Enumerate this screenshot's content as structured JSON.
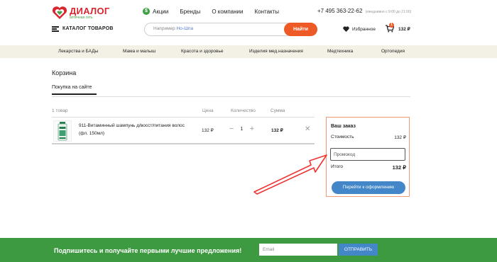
{
  "brand": {
    "name": "ДИАЛОГ",
    "tagline": "аптечная сеть"
  },
  "topnav": {
    "items": [
      {
        "label": "Акции",
        "icon": "dollar-icon"
      },
      {
        "label": "Бренды"
      },
      {
        "label": "О компании"
      },
      {
        "label": "Контакты"
      }
    ]
  },
  "contact": {
    "phone": "+7 495 363-22-62",
    "hours": "(ежедневно с 9:00 до 21:00)"
  },
  "catalog": {
    "label": "КАТАЛОГ ТОВАРОВ"
  },
  "search": {
    "placeholder": "Например",
    "hint": "Но-Шпа",
    "button": "Найти"
  },
  "favorites": {
    "label": "Избранное"
  },
  "cart": {
    "count": "1",
    "total": "132 ₽"
  },
  "categories": [
    "Лекарства и БАДы",
    "Мама и малыш",
    "Красота и здоровье",
    "Изделия мед.назначения",
    "Медтехника",
    "Ортопедия"
  ],
  "page": {
    "title": "Корзина",
    "tab": "Покупка на сайте"
  },
  "table": {
    "count_label": "1 товар",
    "headers": {
      "price": "Цена",
      "quantity": "Количество",
      "sum": "Сумма"
    },
    "rows": [
      {
        "name": "911-Витаминный шампунь д/восст/питания волос (фл. 150мл)",
        "price": "132 ₽",
        "quantity": "1",
        "sum": "132 ₽"
      }
    ]
  },
  "order": {
    "title": "Ваш заказ",
    "cost_label": "Стоимость",
    "cost_value": "132 ₽",
    "promo_placeholder": "Промокод",
    "total_label": "Итого",
    "total_value": "132 ₽",
    "checkout": "Перейти к оформлению"
  },
  "footer": {
    "text": "Подпишитесь и получайте первыми лучшие предложения!",
    "email_placeholder": "Email",
    "send": "ОТПРАВИТЬ"
  },
  "colors": {
    "brand_red": "#d9252f",
    "brand_green": "#3e9a40",
    "accent_orange": "#ee5a25",
    "button_blue": "#4487c8",
    "category_bar": "#f3f1e6"
  }
}
